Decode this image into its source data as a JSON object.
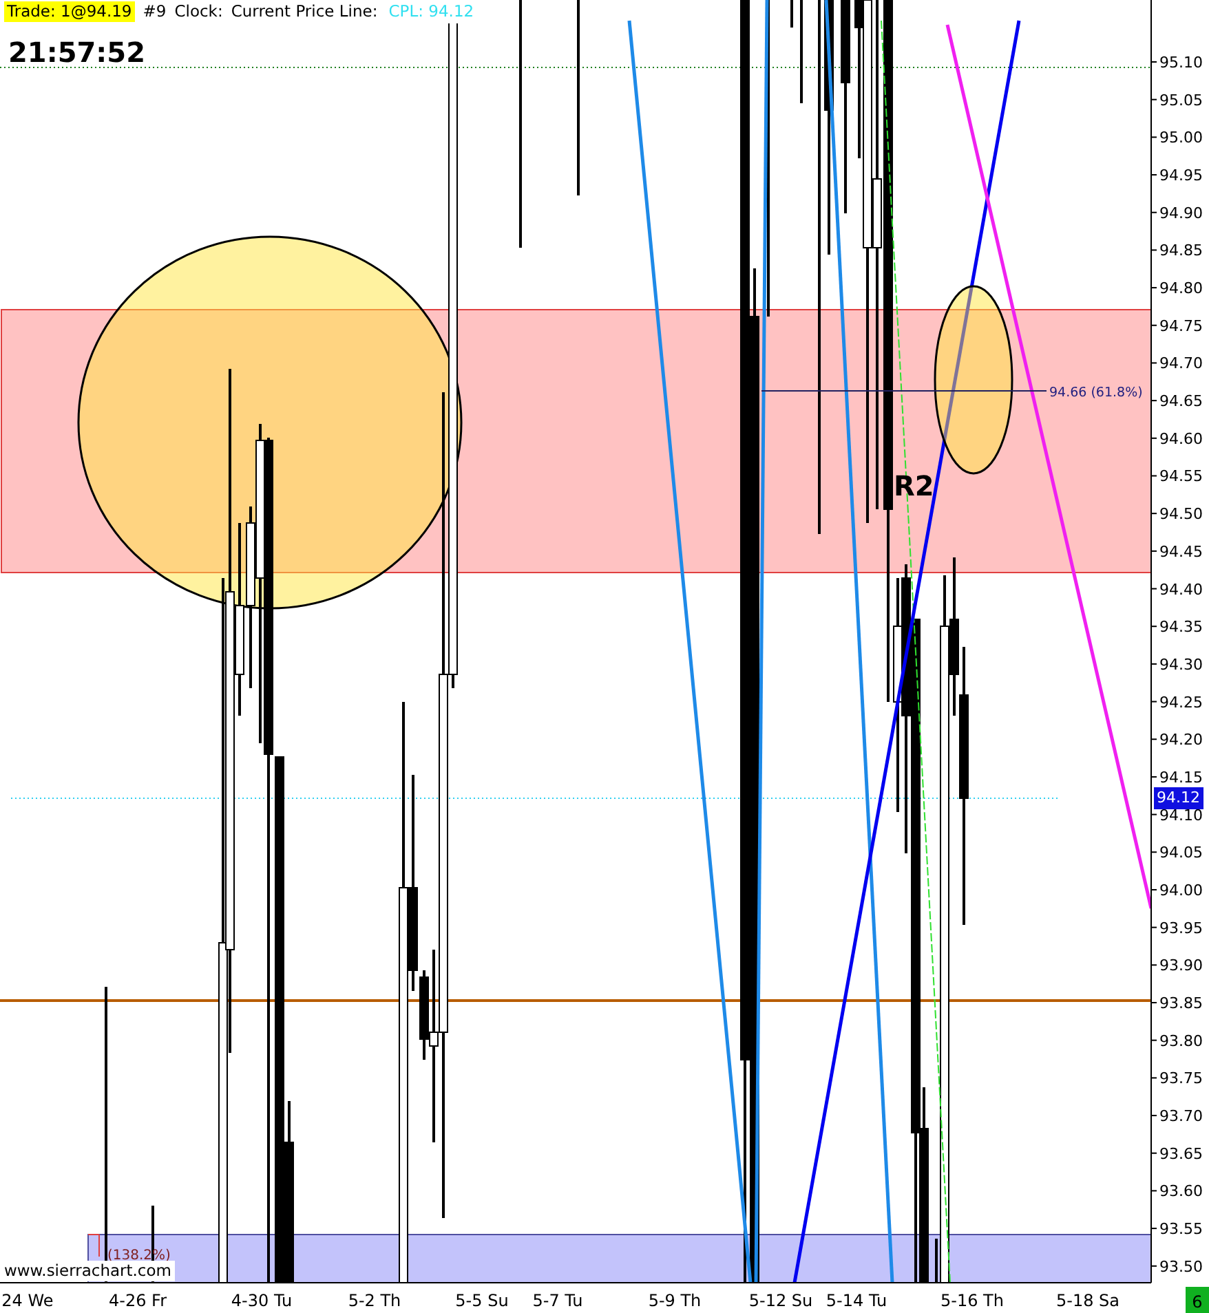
{
  "header": {
    "trade": "Trade: 1@94.19",
    "bar_number": "#9",
    "clock_label": "Clock:",
    "price_line_label": "Current Price Line:",
    "cpl": "CPL: 94.12"
  },
  "clock": "21:57:52",
  "price_axis": [
    "95.10",
    "95.05",
    "95.00",
    "94.95",
    "94.90",
    "94.85",
    "94.80",
    "94.75",
    "94.70",
    "94.65",
    "94.60",
    "94.55",
    "94.50",
    "94.45",
    "94.40",
    "94.35",
    "94.30",
    "94.25",
    "94.20",
    "94.15",
    "94.10",
    "94.05",
    "94.00",
    "93.95",
    "93.90",
    "93.85",
    "93.80",
    "93.75",
    "93.70",
    "93.65",
    "93.60",
    "93.55",
    "93.50"
  ],
  "current_price": "94.12",
  "date_axis": [
    "24 We",
    "4-26 Fr",
    "4-30 Tu",
    "5-2 Th",
    "5-5 Su",
    "5-7 Tu",
    "5-9 Th",
    "5-12 Su",
    "5-14 Tu",
    "5-16 Th",
    "5-18 Sa"
  ],
  "fib_label": "94.66  (61.8%)",
  "extension_label": "(138.2%)",
  "pivot_label": "R2",
  "site_label": "www.sierrachart.com",
  "corner_badge": "6"
}
